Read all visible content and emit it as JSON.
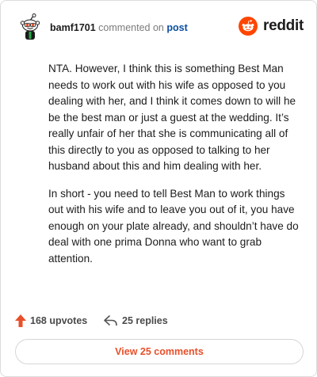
{
  "header": {
    "username": "bamf1701",
    "commented_on": "commented on",
    "post_link": "post",
    "brand": "reddit"
  },
  "comment": {
    "paragraphs": [
      "NTA. However, I think this is something Best Man needs to work out with his wife as opposed to you dealing with her, and I think it comes down to will he be the best man or just a guest at the wedding. It’s really unfair of her that she is communicating all of this directly to you as opposed to talking to her husband about this and him dealing with her.",
      "In short - you need to tell Best Man to work things out with his wife and to leave you out of it, you have enough on your plate already, and shouldn’t have do deal with one prima Donna who want to grab attention."
    ]
  },
  "actions": {
    "upvotes": "168 upvotes",
    "replies": "25 replies",
    "view_comments": "View 25 comments"
  },
  "colors": {
    "accent": "#e8502a",
    "link": "#0a4ea3",
    "brand_orange": "#ff4500"
  },
  "icons": {
    "avatar": "snoo-avatar-icon",
    "brand": "reddit-logo-icon",
    "upvote": "upvote-arrow-icon",
    "reply": "reply-arrow-icon"
  }
}
